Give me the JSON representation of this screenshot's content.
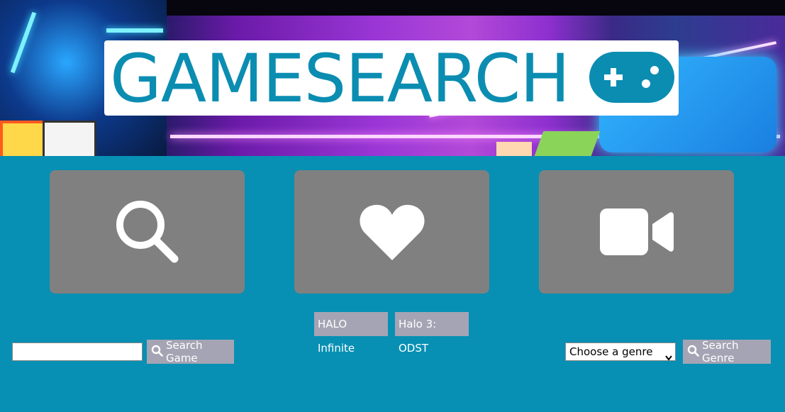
{
  "logo": {
    "text": "GAMESEARCH",
    "icon": "gamepad-icon",
    "color": "#0b8db1"
  },
  "tiles": [
    {
      "icon": "search-icon"
    },
    {
      "icon": "heart-icon"
    },
    {
      "icon": "video-camera-icon"
    }
  ],
  "games": [
    "HALO Infinite",
    "Halo 3: ODST"
  ],
  "search": {
    "input_value": "",
    "button_label": "Search Game",
    "button_icon": "search-icon"
  },
  "genre": {
    "selected": "Choose a genre",
    "button_label": "Search Genre",
    "button_icon": "search-icon"
  },
  "colors": {
    "background": "#0790b3",
    "tile": "#808080",
    "button": "#a4a4b4"
  }
}
